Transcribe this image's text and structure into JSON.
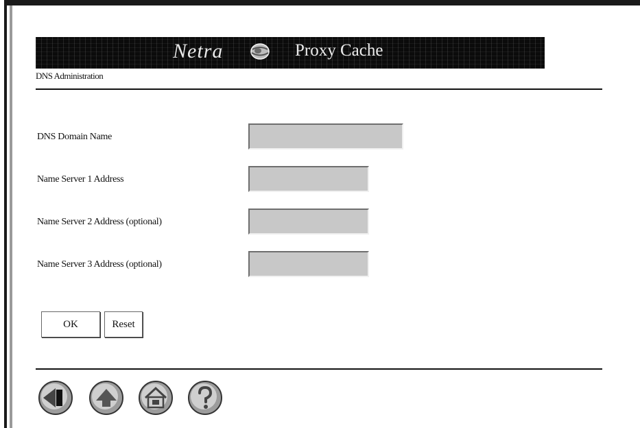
{
  "banner": {
    "logo_text": "Netra",
    "product": "Proxy Cache"
  },
  "page": {
    "subtitle": "DNS Administration"
  },
  "form": {
    "fields": [
      {
        "label": "DNS Domain Name",
        "value": ""
      },
      {
        "label": "Name Server 1 Address",
        "value": ""
      },
      {
        "label": "Name Server 2 Address (optional)",
        "value": ""
      },
      {
        "label": "Name Server 3 Address (optional)",
        "value": ""
      }
    ],
    "ok_label": "OK",
    "reset_label": "Reset"
  },
  "nav": {
    "icons": [
      "back-icon",
      "up-icon",
      "home-icon",
      "help-icon"
    ]
  }
}
